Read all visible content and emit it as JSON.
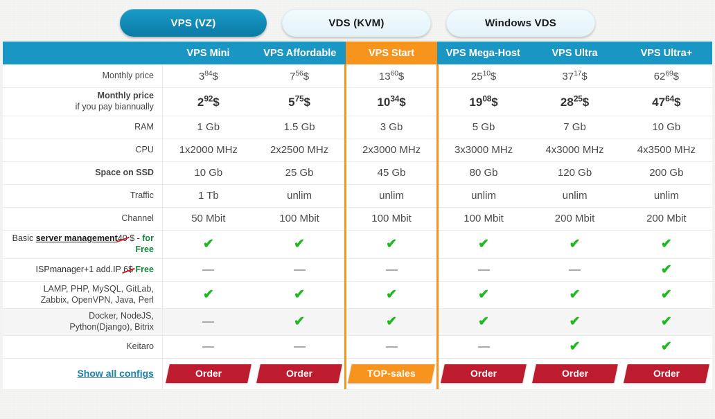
{
  "tabs": [
    {
      "label": "VPS (VZ)",
      "active": true
    },
    {
      "label": "VDS (KVM)",
      "active": false
    },
    {
      "label": "Windows VDS",
      "active": false
    }
  ],
  "accent_colors": {
    "header_blue": "#1a96c4",
    "highlight_orange": "#f7941d",
    "order_red": "#bc1c2e",
    "check_green": "#20b820",
    "free_green": "#14863a",
    "strike_red": "#cc2222",
    "link_blue": "#1a7fa8"
  },
  "table": {
    "corner_label": "",
    "columns": [
      {
        "name": "VPS Mini",
        "highlight": false
      },
      {
        "name": "VPS Affordable",
        "highlight": false
      },
      {
        "name": "VPS Start",
        "highlight": true
      },
      {
        "name": "VPS Mega-Host",
        "highlight": false
      },
      {
        "name": "VPS Ultra",
        "highlight": false
      },
      {
        "name": "VPS Ultra+",
        "highlight": false
      }
    ],
    "rows": {
      "monthly_price": {
        "label": "Monthly price",
        "values": [
          {
            "int": "3",
            "cents": "84",
            "cur": "$"
          },
          {
            "int": "7",
            "cents": "56",
            "cur": "$"
          },
          {
            "int": "13",
            "cents": "60",
            "cur": "$"
          },
          {
            "int": "25",
            "cents": "10",
            "cur": "$"
          },
          {
            "int": "37",
            "cents": "17",
            "cur": "$"
          },
          {
            "int": "62",
            "cents": "69",
            "cur": "$"
          }
        ]
      },
      "biannual_price": {
        "label_line1": "Monthly price",
        "label_line2": "if you pay biannually",
        "values": [
          {
            "int": "2",
            "cents": "92",
            "cur": "$"
          },
          {
            "int": "5",
            "cents": "75",
            "cur": "$"
          },
          {
            "int": "10",
            "cents": "34",
            "cur": "$"
          },
          {
            "int": "19",
            "cents": "08",
            "cur": "$"
          },
          {
            "int": "28",
            "cents": "25",
            "cur": "$"
          },
          {
            "int": "47",
            "cents": "64",
            "cur": "$"
          }
        ]
      },
      "ram": {
        "label": "RAM",
        "values": [
          "1 Gb",
          "1.5 Gb",
          "3 Gb",
          "5 Gb",
          "7 Gb",
          "10 Gb"
        ]
      },
      "cpu": {
        "label": "CPU",
        "values": [
          "1x2000 MHz",
          "2x2500 MHz",
          "2x3000 MHz",
          "3x3000 MHz",
          "4x3000 MHz",
          "4x3500 MHz"
        ]
      },
      "ssd": {
        "label": "Space on SSD",
        "values": [
          "10 Gb",
          "25 Gb",
          "45 Gb",
          "80 Gb",
          "120 Gb",
          "200 Gb"
        ]
      },
      "traffic": {
        "label": "Traffic",
        "values": [
          "1 Tb",
          "unlim",
          "unlim",
          "unlim",
          "unlim",
          "unlim"
        ]
      },
      "channel": {
        "label": "Channel",
        "values": [
          "50 Mbit",
          "100 Mbit",
          "100 Mbit",
          "100 Mbit",
          "200 Mbit",
          "200 Mbit"
        ]
      },
      "management": {
        "label_parts": {
          "prefix": "Basic ",
          "underlined": "server management",
          "struck": "40",
          "mid": " $ - ",
          "free": "for Free"
        },
        "values": [
          "check",
          "check",
          "check",
          "check",
          "check",
          "check"
        ]
      },
      "ispmanager": {
        "label_parts": {
          "prefix": "ISPmanager+1 add.IP ",
          "struck": "6$",
          "free": "Free"
        },
        "values": [
          "dash",
          "dash",
          "dash",
          "dash",
          "dash",
          "check"
        ]
      },
      "lamp": {
        "label_line1": "LAMP, PHP, MySQL, GitLab,",
        "label_line2": "Zabbix, OpenVPN, Java, Perl",
        "values": [
          "check",
          "check",
          "check",
          "check",
          "check",
          "check"
        ]
      },
      "docker": {
        "label_line1": "Docker, NodeJS,",
        "label_line2": "Python(Django), Bitrix",
        "values": [
          "dash",
          "check",
          "check",
          "check",
          "check",
          "check"
        ]
      },
      "keitaro": {
        "label": "Keitaro",
        "values": [
          "dash",
          "dash",
          "dash",
          "dash",
          "check",
          "check"
        ]
      }
    },
    "footer": {
      "show_all_label": "Show all configs",
      "buttons": [
        {
          "label": "Order",
          "style": "red"
        },
        {
          "label": "Order",
          "style": "red"
        },
        {
          "label": "TOP-sales",
          "style": "orange"
        },
        {
          "label": "Order",
          "style": "red"
        },
        {
          "label": "Order",
          "style": "red"
        },
        {
          "label": "Order",
          "style": "red"
        }
      ]
    }
  }
}
